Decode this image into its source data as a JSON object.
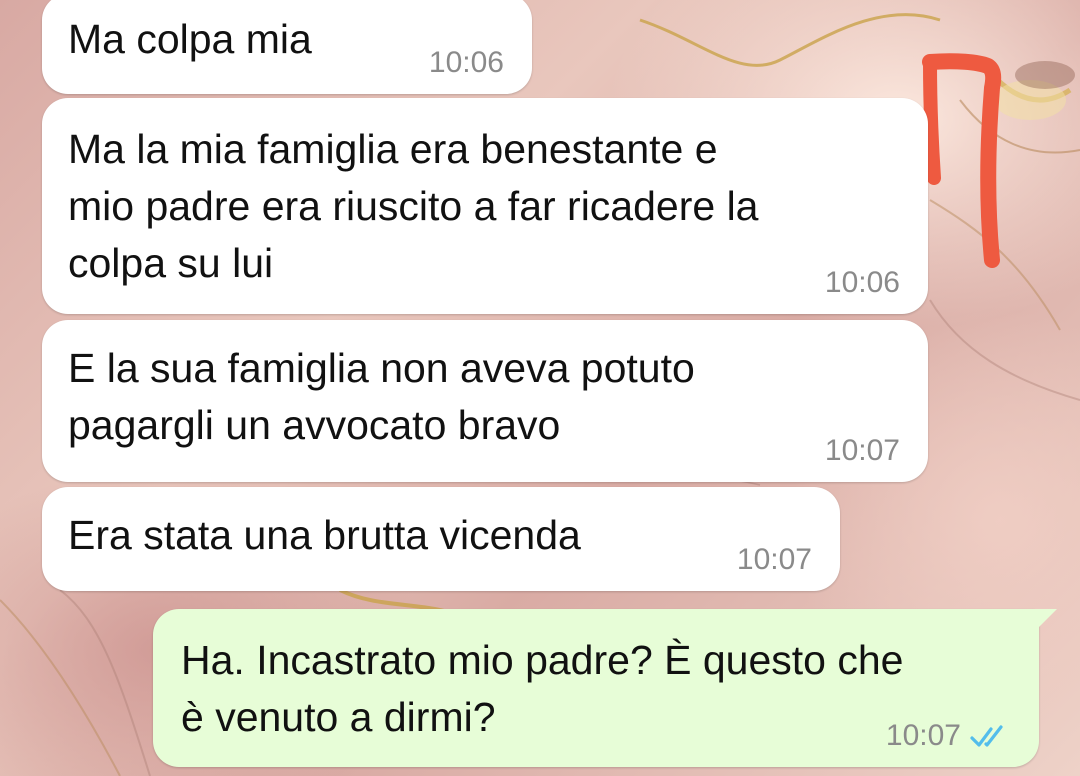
{
  "messages": [
    {
      "text": "Ma colpa mia",
      "time": "10:06",
      "direction": "incoming"
    },
    {
      "text": "Ma la mia famiglia era benestante e\nmio padre era riuscito a far ricadere la\ncolpa su lui",
      "time": "10:06",
      "direction": "incoming"
    },
    {
      "text": "E la sua famiglia non aveva potuto\npagargli un avvocato bravo",
      "time": "10:07",
      "direction": "incoming"
    },
    {
      "text": "Era stata una brutta vicenda",
      "time": "10:07",
      "direction": "incoming"
    },
    {
      "text": "Ha. Incastrato mio padre? È questo che\nè venuto a dirmi?",
      "time": "10:07",
      "direction": "outgoing",
      "status": "read"
    }
  ],
  "icons": {
    "read_receipt": "double-check-icon",
    "annotation": "handwritten-seven-mark"
  },
  "colors": {
    "incoming_bubble": "#ffffff",
    "outgoing_bubble": "#e7fdd7",
    "read_receipt": "#53bdeb",
    "annotation": "#ee5a40",
    "timestamp": "#8a8a8a"
  }
}
